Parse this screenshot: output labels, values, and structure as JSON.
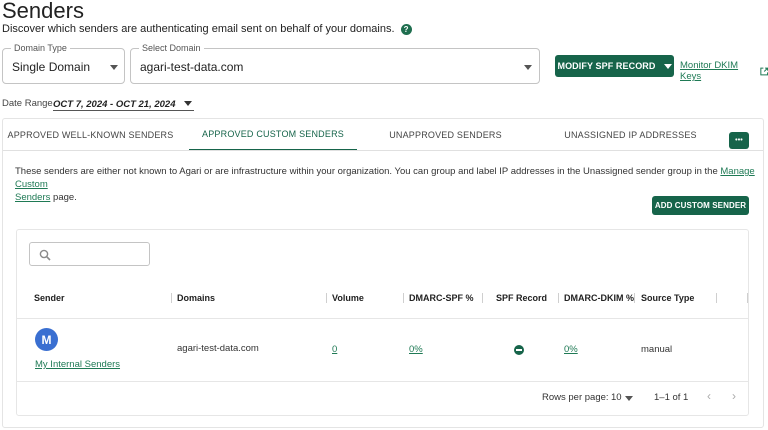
{
  "header": {
    "title": "Senders",
    "subtitle": "Discover which senders are authenticating email sent on behalf of your domains.",
    "help_glyph": "?"
  },
  "filters": {
    "domain_type": {
      "label": "Domain Type",
      "value": "Single Domain"
    },
    "select_domain": {
      "label": "Select Domain",
      "value": "agari-test-data.com"
    },
    "modify_spf_button": "MODIFY SPF RECORD",
    "monitor_dkim_link": "Monitor DKIM Keys",
    "date_range": {
      "label": "Date Range",
      "value": "OCT 7, 2024 - OCT 21, 2024"
    }
  },
  "tabs": [
    {
      "label": "APPROVED WELL-KNOWN SENDERS",
      "active": false
    },
    {
      "label": "APPROVED CUSTOM SENDERS",
      "active": true
    },
    {
      "label": "UNAPPROVED SENDERS",
      "active": false
    },
    {
      "label": "UNASSIGNED IP ADDRESSES",
      "active": false
    }
  ],
  "more_button": "•••",
  "description": {
    "text": "These senders are either not known to Agari or are infrastructure within your organization. You can group and label IP addresses in the Unassigned sender group in the",
    "link_line1": "Manage Custom",
    "link_line2": "Senders",
    "suffix": "page."
  },
  "add_custom_sender_button": "ADD CUSTOM SENDER",
  "table": {
    "search_placeholder": "",
    "columns": [
      "Sender",
      "Domains",
      "Volume",
      "DMARC-SPF %",
      "SPF Record",
      "DMARC-DKIM %",
      "Source Type"
    ],
    "rows": [
      {
        "avatar_letter": "M",
        "sender": "My Internal Senders",
        "domains": "agari-test-data.com",
        "volume": "0",
        "dmarc_spf": "0%",
        "spf_record_icon": "minus-circle-icon",
        "dmarc_dkim": "0%",
        "source_type": "manual"
      }
    ],
    "footer": {
      "rows_per_page_label": "Rows per page:",
      "rows_per_page_value": "10",
      "range": "1–1 of 1",
      "prev_glyph": "‹",
      "next_glyph": "›"
    }
  },
  "colors": {
    "brand_green": "#16644a",
    "avatar_blue": "#3a6fd1"
  }
}
